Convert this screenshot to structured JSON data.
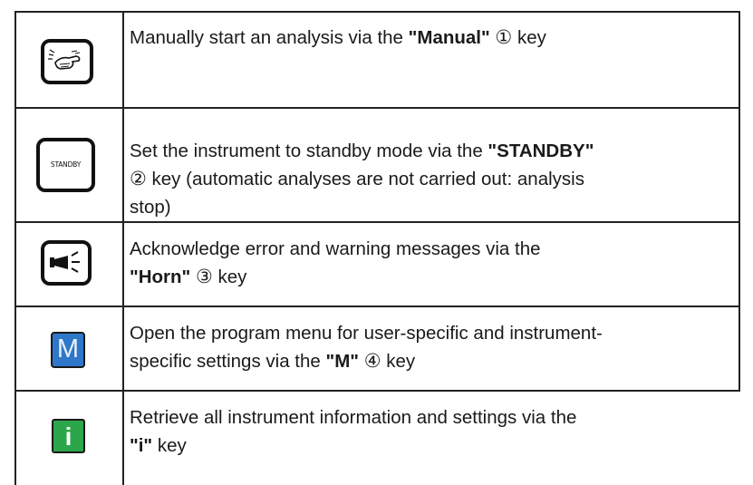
{
  "rows": [
    {
      "icon": "manual-hand-icon",
      "pre": "Manually start an analysis via the ",
      "key": "\"Manual\"",
      "num": "①",
      "post": " key"
    },
    {
      "icon": "standby-key-icon",
      "icon_text": "STANDBY",
      "line1_pre": "Set the instrument to standby mode via the ",
      "line1_key": "\"STANDBY\"",
      "line2_num": "②",
      "line2_post": " key (automatic analyses are not carried out: analysis",
      "line3": "stop)"
    },
    {
      "icon": "horn-icon",
      "line1": "Acknowledge error and warning messages via the",
      "line2_key": "\"Horn\"",
      "line2_num": "③",
      "line2_post": " key"
    },
    {
      "icon": "menu-m-icon",
      "icon_text": "M",
      "line1": "Open the program menu for user-specific and instrument-",
      "line2_pre": "specific settings via the ",
      "line2_key": "\"M\"",
      "line2_num": "④",
      "line2_post": " key"
    },
    {
      "icon": "info-i-icon",
      "icon_text": "i",
      "line1": "Retrieve all instrument information and settings via the",
      "line2_key": "\"i\"",
      "line2_post": " key"
    }
  ],
  "colors": {
    "menu_key": "#2f77c8",
    "info_key": "#2ca64a",
    "border": "#222222"
  }
}
